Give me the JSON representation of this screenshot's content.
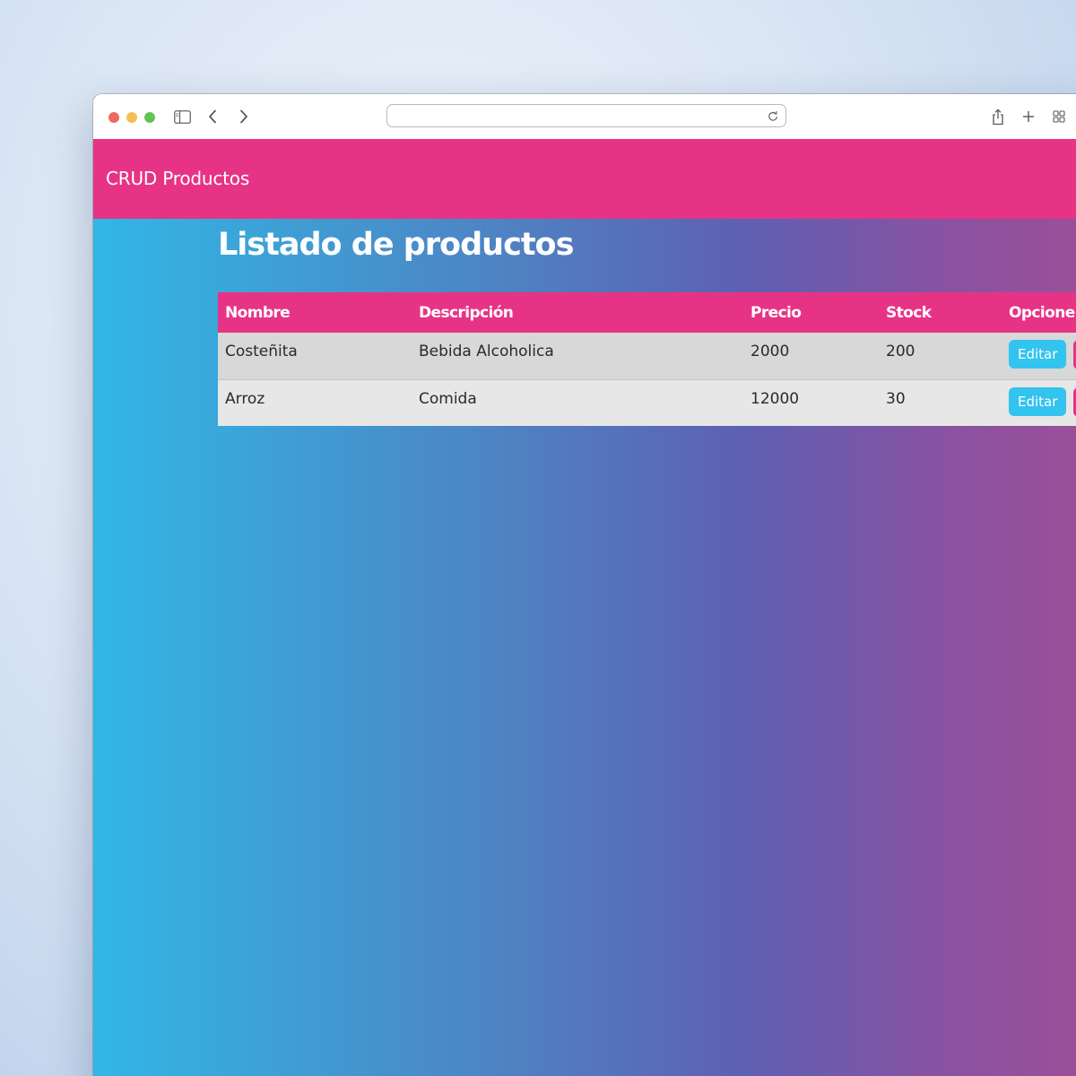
{
  "browser": {
    "address": ""
  },
  "app": {
    "brand": "CRUD Productos",
    "page_title": "Listado de productos"
  },
  "table": {
    "columns": [
      "Nombre",
      "Descripción",
      "Precio",
      "Stock",
      "Opcione"
    ],
    "rows": [
      {
        "nombre": "Costeñita",
        "descripcion": "Bebida Alcoholica",
        "precio": "2000",
        "stock": "200",
        "edit_label": "Editar"
      },
      {
        "nombre": "Arroz",
        "descripcion": "Comida",
        "precio": "12000",
        "stock": "30",
        "edit_label": "Editar"
      }
    ]
  },
  "colors": {
    "navbar": "#e73385",
    "header_row": "#e73385",
    "edit_button": "#33c3ef",
    "gradient_start": "#31b7e4",
    "gradient_end": "#9b4f98"
  },
  "icons": [
    "sidebar-icon",
    "back-chevron-icon",
    "forward-chevron-icon",
    "reload-icon",
    "share-icon",
    "new-tab-plus-icon",
    "tab-overview-icon"
  ]
}
